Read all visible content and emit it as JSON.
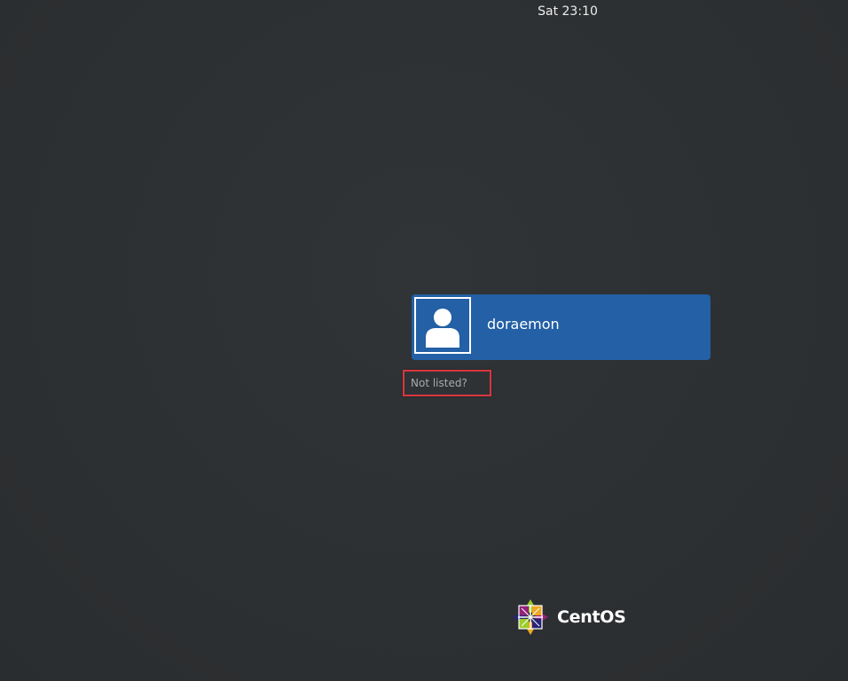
{
  "top_bar": {
    "clock": "Sat 23:10"
  },
  "user_list": {
    "users": [
      {
        "name": "doraemon",
        "avatar_icon": "user-avatar-icon"
      }
    ]
  },
  "not_listed": {
    "label": "Not listed?"
  },
  "branding": {
    "logo_text": "CentOS",
    "logo_icon": "centos-logo-icon"
  },
  "colors": {
    "background": "#2e3133",
    "user_card": "#2360a5",
    "highlight_box": "#d9363e"
  }
}
